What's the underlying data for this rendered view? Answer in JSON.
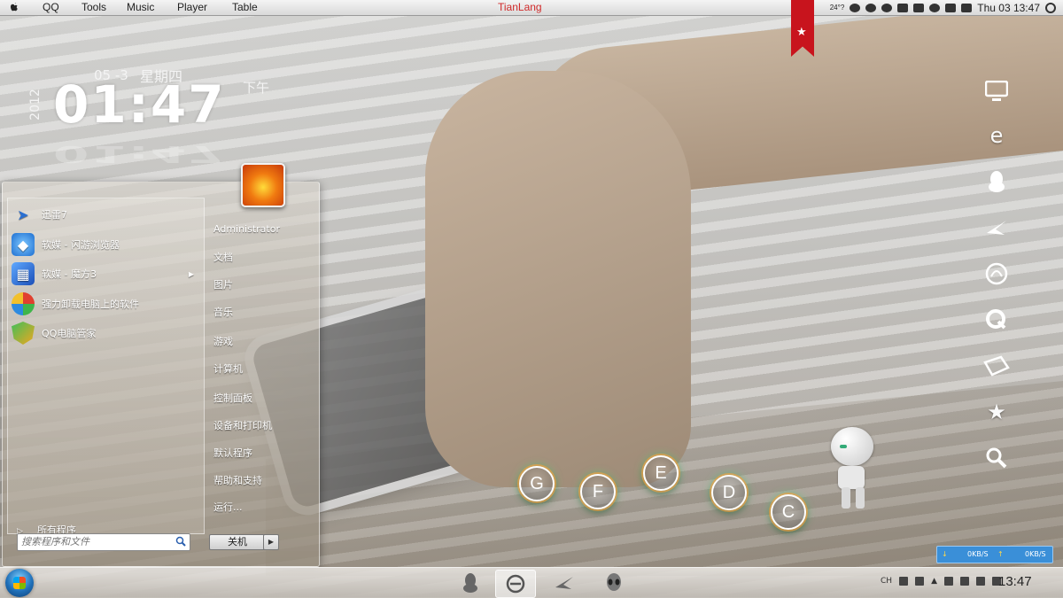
{
  "menubar": {
    "items": [
      "QQ",
      "Tools",
      "Music",
      "Player",
      "Table"
    ],
    "center_title": "TianLang",
    "temperature": "24°?",
    "datetime": "Thu 03  13:47"
  },
  "clock": {
    "date": "05 -3",
    "weekday": "星期四",
    "time": "01:47",
    "ampm": "下午",
    "year": "2012"
  },
  "dock": {
    "icons": [
      "monitor-icon",
      "ie-icon",
      "qq-icon",
      "bird-icon",
      "headphones-icon",
      "q-icon",
      "folder-icon",
      "star-icon",
      "search-icon"
    ]
  },
  "drives": [
    "G",
    "F",
    "E",
    "D",
    "C"
  ],
  "startmenu": {
    "programs": [
      {
        "label": "迅雷7",
        "icon": "thunder-icon",
        "color": "#2a6fd1"
      },
      {
        "label": "软媒 - 闪游浏览器",
        "icon": "browser-icon",
        "color": "#2d8ae0"
      },
      {
        "label": "软媒 - 魔方3",
        "icon": "cube-icon",
        "color": "#2d6ed6"
      },
      {
        "label": "强力卸载电脑上的软件",
        "icon": "uninstall-icon",
        "color": "#e0402f"
      },
      {
        "label": "QQ电脑管家",
        "icon": "shield-icon",
        "color": "#f0a61e"
      }
    ],
    "all_programs": "所有程序",
    "search_placeholder": "搜索程序和文件",
    "right_links": [
      "Administrator",
      "文档",
      "图片",
      "音乐",
      "游戏",
      "计算机",
      "控制面板",
      "设备和打印机",
      "默认程序",
      "帮助和支持",
      "运行..."
    ],
    "shutdown": "关机"
  },
  "netmeter": {
    "down": "0KB/S",
    "up": "0KB/S"
  },
  "taskbar": {
    "lang": "CH",
    "clock": "13:47"
  }
}
